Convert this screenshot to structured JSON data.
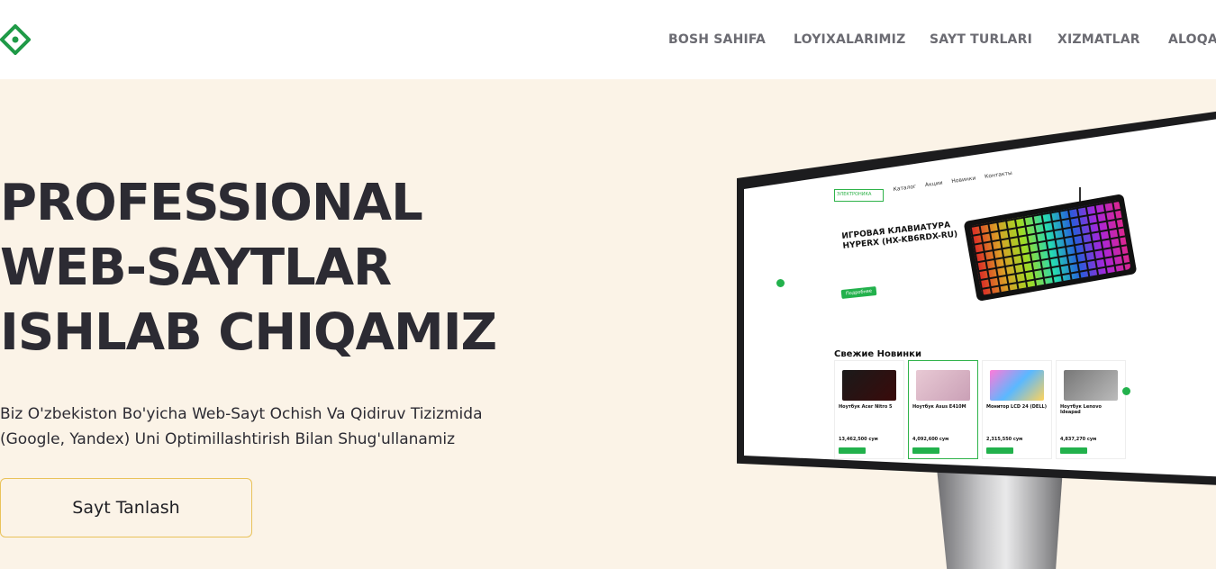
{
  "header": {
    "logo_icon": "diamond-logo-icon",
    "nav": [
      {
        "label": "BOSH SAHIFA"
      },
      {
        "label": "LOYIXALARIMIZ"
      },
      {
        "label": "SAYT TURLARI"
      },
      {
        "label": "XIZMATLAR"
      },
      {
        "label": "ALOQA"
      }
    ]
  },
  "hero": {
    "title_lines": [
      "PROFESSIONAL",
      "WEB-SAYTLAR",
      "ISHLAB CHIQAMIZ"
    ],
    "subtitle_line1": "Biz O'zbekiston Bo'yicha Web-Sayt Ochish Va Qidiruv Tizizmida",
    "subtitle_line2": "(Google, Yandex) Uni Optimillashtirish Bilan Shug'ullanamiz",
    "cta_label": "Sayt Tanlash"
  },
  "mockup": {
    "brand": "ЭЛЕКТРОНИКА",
    "menu": [
      "Каталог",
      "Акции",
      "Новинки",
      "Контакты"
    ],
    "banner_title": "ИГРОВАЯ КЛАВИАТУРА HYPERX (HX-KB6RDX-RU)",
    "banner_button": "Подробнее",
    "section_title": "Свежие Новинки",
    "products": [
      {
        "name": "Ноутбук Acer Nitro 5",
        "price": "13,462,500 сум"
      },
      {
        "name": "Ноутбук Asus E410M",
        "price": "4,092,600 сум"
      },
      {
        "name": "Монитор LCD 24 (DELL)",
        "price": "2,315,550 сум"
      },
      {
        "name": "Ноутбук Lenovo Ideapad",
        "price": "4,837,270 сум"
      }
    ]
  },
  "colors": {
    "accent": "#22b14c",
    "hero_bg": "#fbf3e7",
    "cta_border": "#e9c25a"
  }
}
